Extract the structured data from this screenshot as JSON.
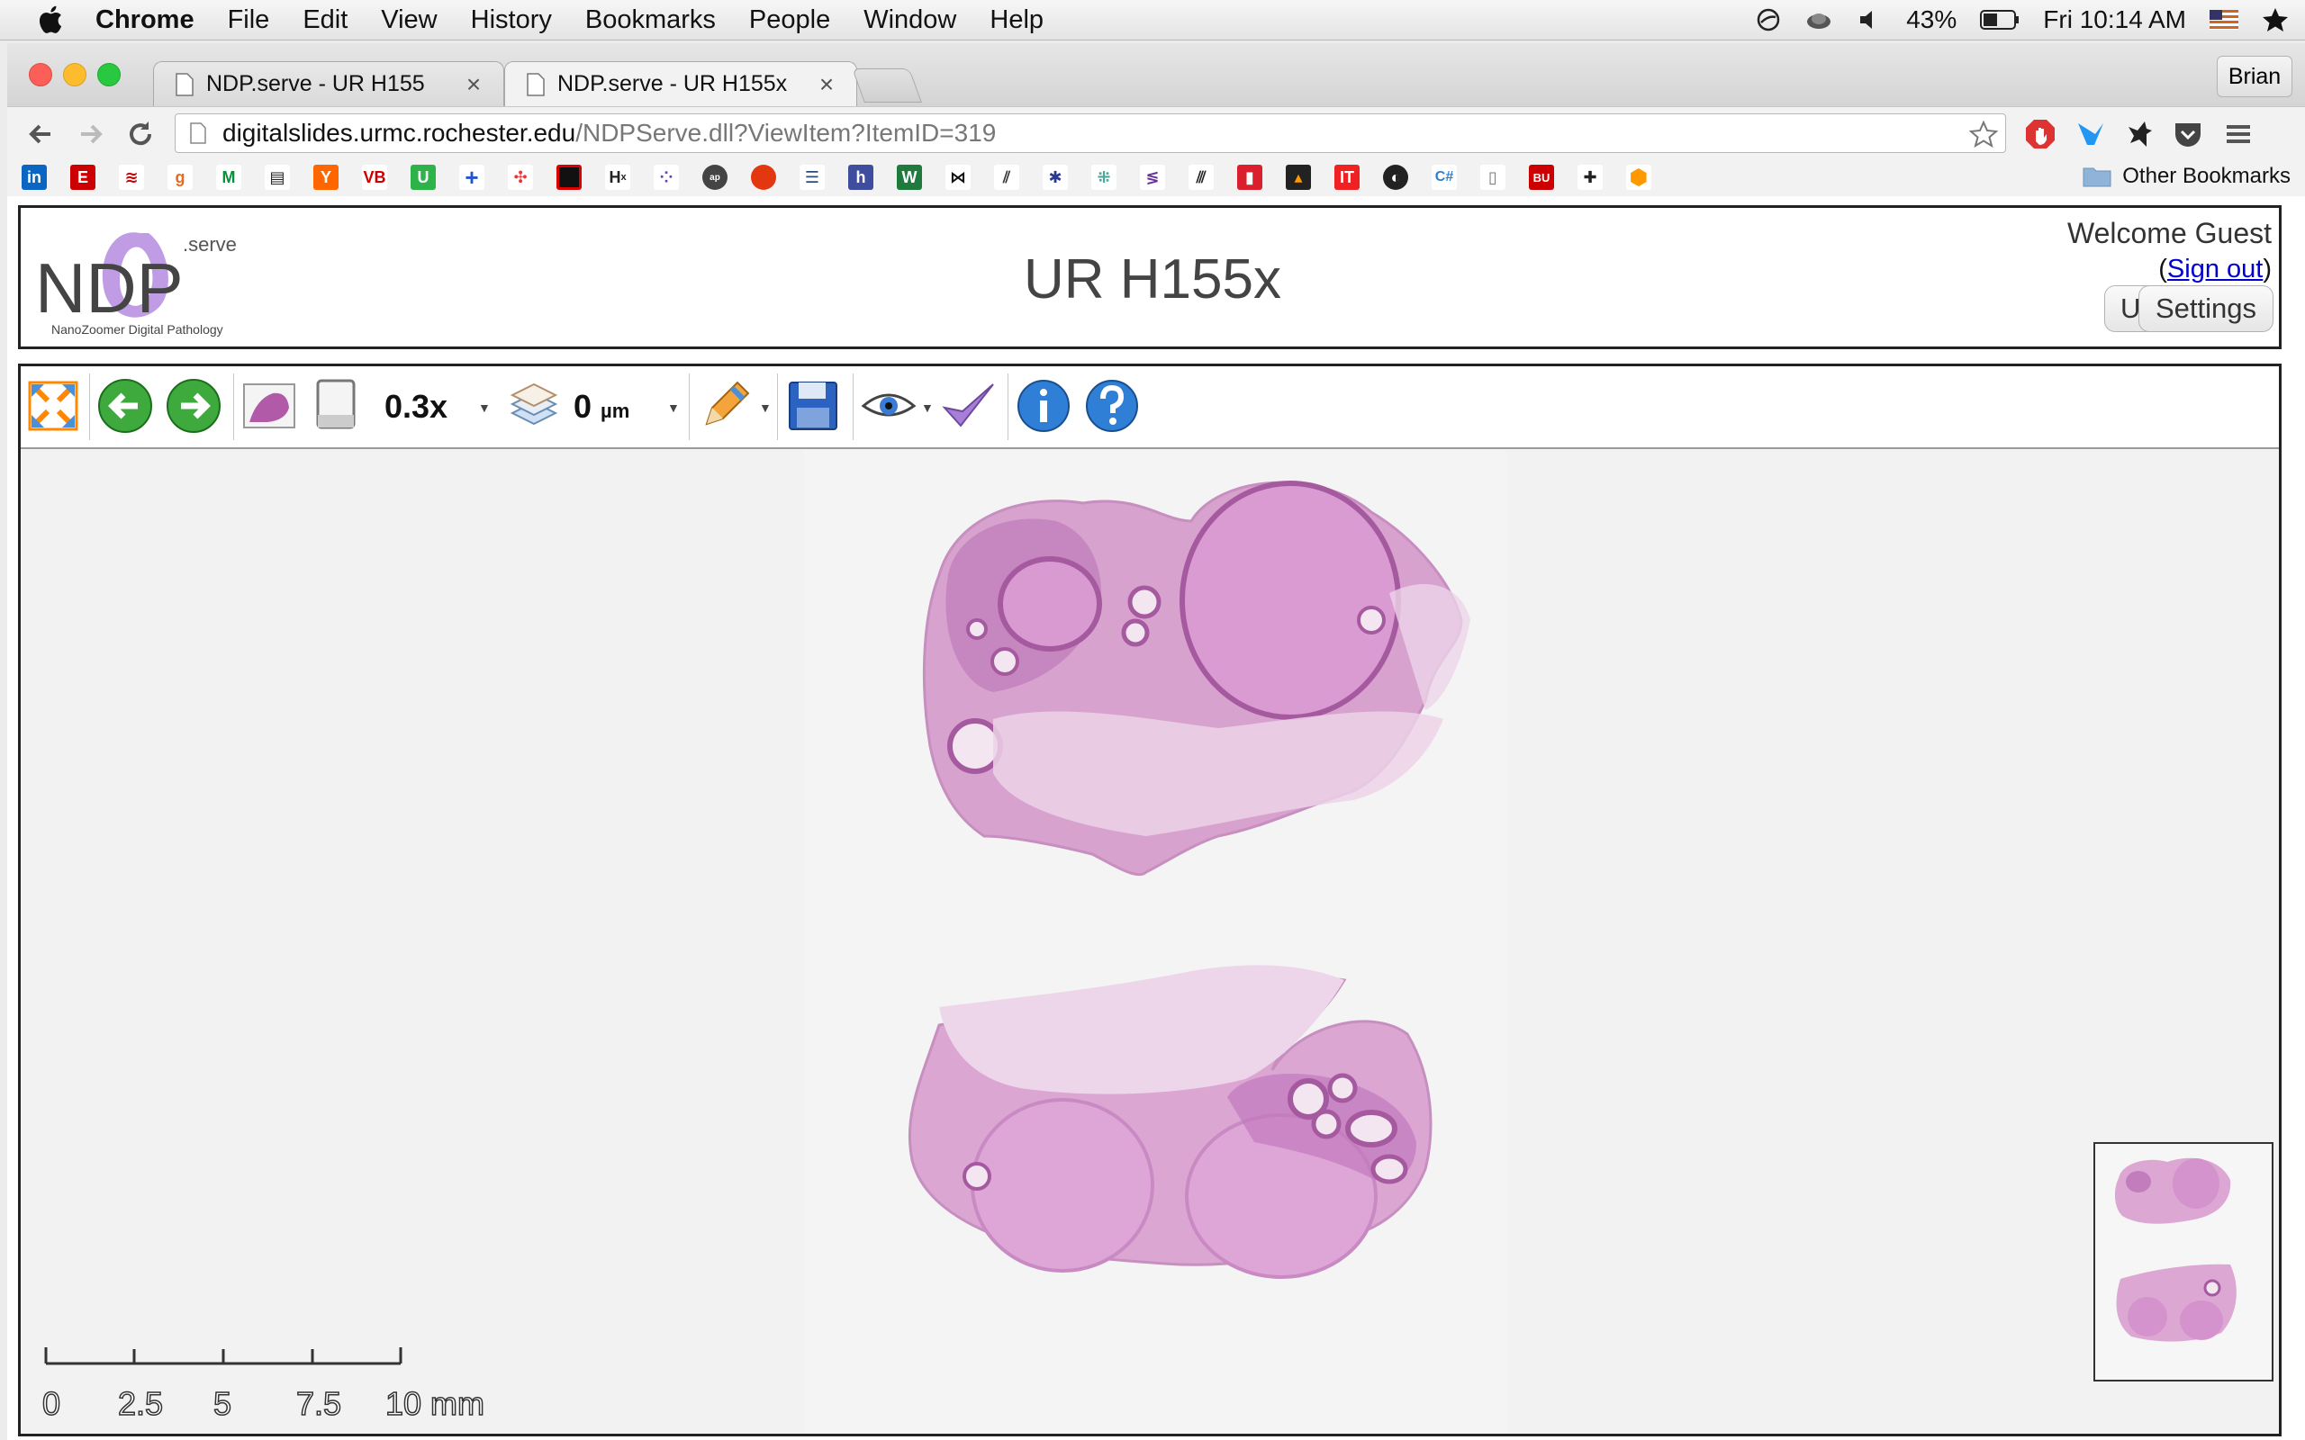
{
  "menubar": {
    "app_name": "Chrome",
    "items": [
      "File",
      "Edit",
      "View",
      "History",
      "Bookmarks",
      "People",
      "Window",
      "Help"
    ],
    "battery": "43%",
    "clock": "Fri 10:14 AM"
  },
  "browser": {
    "tabs": [
      {
        "title": "NDP.serve - UR H155",
        "active": false
      },
      {
        "title": "NDP.serve - UR H155x",
        "active": true
      }
    ],
    "profile": "Brian",
    "url_host": "digitalslides.urmc.rochester.edu",
    "url_path": "/NDPServe.dll?ViewItem?ItemID=319",
    "other_bookmarks": "Other Bookmarks"
  },
  "ndp": {
    "logo_sup": ".serve",
    "logo_text": "NDP",
    "logo_sub": "NanoZoomer Digital Pathology",
    "title": "UR H155x",
    "welcome": "Welcome Guest",
    "sign_out": "Sign out",
    "url_button": "URL",
    "settings_button": "Settings"
  },
  "viewer": {
    "zoom": "0.3x",
    "focus_value": "0",
    "focus_unit": "µm",
    "scale_labels": [
      "0",
      "2.5",
      "5",
      "7.5",
      "10 mm"
    ]
  }
}
